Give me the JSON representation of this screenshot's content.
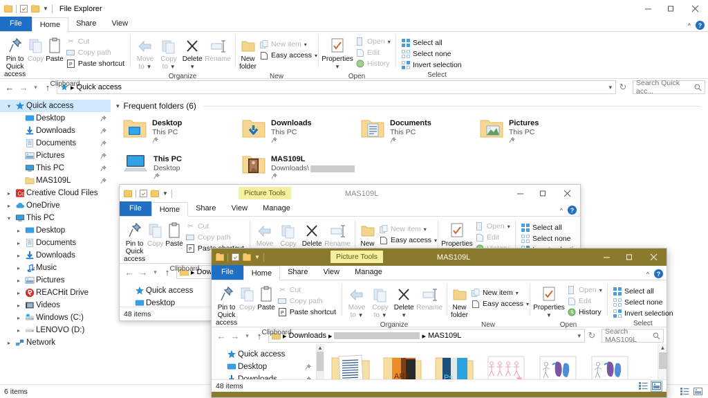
{
  "ribbon": {
    "clipboard": {
      "label": "Clipboard",
      "pin": "Pin to Quick\naccess",
      "pin_line1": "Pin to Quick",
      "pin_line2": "access",
      "copy": "Copy",
      "paste": "Paste",
      "cut": "Cut",
      "copy_path": "Copy path",
      "paste_shortcut": "Paste shortcut"
    },
    "organize": {
      "label": "Organize",
      "move_to_l1": "Move",
      "move_to_l2": "to",
      "copy_to_l1": "Copy",
      "copy_to_l2": "to",
      "delete": "Delete",
      "rename": "Rename"
    },
    "new": {
      "label": "New",
      "new_folder_l1": "New",
      "new_folder_l2": "folder",
      "new_item": "New item",
      "easy_access": "Easy access"
    },
    "open": {
      "label": "Open",
      "properties": "Properties",
      "open": "Open",
      "edit": "Edit",
      "history": "History"
    },
    "select": {
      "label": "Select",
      "select_all": "Select all",
      "select_none": "Select none",
      "invert_selection": "Invert selection"
    },
    "tabs": {
      "file": "File",
      "home": "Home",
      "share": "Share",
      "view": "View",
      "manage": "Manage"
    }
  },
  "window_main": {
    "title": "File Explorer",
    "address": {
      "crumb_root": "Quick access"
    },
    "search_placeholder": "Search Quick acc...",
    "frequent_header": "Frequent folders (6)",
    "status_items": "6 items",
    "minimize": "—",
    "maximize": "❐",
    "close": "✕",
    "tiles": [
      {
        "name": "Desktop",
        "sub": "This PC",
        "icon": "folder-desktop-icon",
        "pinned": true
      },
      {
        "name": "Downloads",
        "sub": "This PC",
        "icon": "folder-downloads-icon",
        "pinned": true
      },
      {
        "name": "Documents",
        "sub": "This PC",
        "icon": "folder-documents-icon",
        "pinned": true
      },
      {
        "name": "Pictures",
        "sub": "This PC",
        "icon": "folder-pictures-icon",
        "pinned": true
      },
      {
        "name": "This PC",
        "sub": "Desktop",
        "icon": "this-pc-icon",
        "pinned": true
      },
      {
        "name": "MAS109L",
        "sub": "Downloads\\",
        "icon": "folder-photo-icon",
        "pinned": true,
        "redacted": true
      }
    ],
    "nav": {
      "quick_access": "Quick access",
      "items": [
        {
          "label": "Quick access",
          "icon": "star-icon",
          "indent": 0,
          "expander": "v",
          "selected": true,
          "pin": false
        },
        {
          "label": "Desktop",
          "icon": "desktop-icon",
          "indent": 1,
          "expander": "",
          "selected": false,
          "pin": true
        },
        {
          "label": "Downloads",
          "icon": "download-icon",
          "indent": 1,
          "expander": "",
          "selected": false,
          "pin": true
        },
        {
          "label": "Documents",
          "icon": "document-icon",
          "indent": 1,
          "expander": "",
          "selected": false,
          "pin": true
        },
        {
          "label": "Pictures",
          "icon": "picture-icon",
          "indent": 1,
          "expander": "",
          "selected": false,
          "pin": true
        },
        {
          "label": "This PC",
          "icon": "monitor-icon",
          "indent": 1,
          "expander": "",
          "selected": false,
          "pin": true
        },
        {
          "label": "MAS109L",
          "icon": "folder-icon",
          "indent": 1,
          "expander": "",
          "selected": false,
          "pin": true
        },
        {
          "label": "Creative Cloud Files",
          "icon": "creative-cloud-icon",
          "indent": 0,
          "expander": ">",
          "selected": false,
          "pin": false
        },
        {
          "label": "OneDrive",
          "icon": "onedrive-icon",
          "indent": 0,
          "expander": ">",
          "selected": false,
          "pin": false
        },
        {
          "label": "This PC",
          "icon": "monitor-icon",
          "indent": 0,
          "expander": "v",
          "selected": false,
          "pin": false
        },
        {
          "label": "Desktop",
          "icon": "desktop-icon",
          "indent": 1,
          "expander": ">",
          "selected": false,
          "pin": false
        },
        {
          "label": "Documents",
          "icon": "document-icon",
          "indent": 1,
          "expander": ">",
          "selected": false,
          "pin": false
        },
        {
          "label": "Downloads",
          "icon": "download-icon",
          "indent": 1,
          "expander": ">",
          "selected": false,
          "pin": false
        },
        {
          "label": "Music",
          "icon": "music-note-icon",
          "indent": 1,
          "expander": ">",
          "selected": false,
          "pin": false
        },
        {
          "label": "Pictures",
          "icon": "picture-icon",
          "indent": 1,
          "expander": ">",
          "selected": false,
          "pin": false
        },
        {
          "label": "REACHit Drive",
          "icon": "reachit-icon",
          "indent": 1,
          "expander": ">",
          "selected": false,
          "pin": false
        },
        {
          "label": "Videos",
          "icon": "video-icon",
          "indent": 1,
          "expander": ">",
          "selected": false,
          "pin": false
        },
        {
          "label": "Windows (C:)",
          "icon": "drive-windows-icon",
          "indent": 1,
          "expander": ">",
          "selected": false,
          "pin": false
        },
        {
          "label": "LENOVO (D:)",
          "icon": "drive-icon",
          "indent": 1,
          "expander": ">",
          "selected": false,
          "pin": false
        },
        {
          "label": "Network",
          "icon": "network-icon",
          "indent": 0,
          "expander": ">",
          "selected": false,
          "pin": false
        }
      ]
    }
  },
  "window_middle": {
    "title": "MAS109L",
    "context_tab": "Picture Tools",
    "status_items": "48 items",
    "address_crumb1": "Dow",
    "nav_items": [
      {
        "label": "Quick access",
        "icon": "star-icon"
      },
      {
        "label": "Desktop",
        "icon": "desktop-icon"
      }
    ],
    "minimize": "—",
    "maximize": "❐",
    "close": "✕"
  },
  "window_front": {
    "title": "MAS109L",
    "context_tab": "Picture Tools",
    "status_items": "48 items",
    "search_placeholder": "Search MAS109L",
    "breadcrumbs": [
      {
        "text": "Downloads",
        "redacted": false
      },
      {
        "text": "",
        "redacted": true
      },
      {
        "text": "MAS109L",
        "redacted": false
      }
    ],
    "nav_items": [
      {
        "label": "Quick access",
        "icon": "star-icon",
        "pin": false
      },
      {
        "label": "Desktop",
        "icon": "desktop-icon",
        "pin": true
      },
      {
        "label": "Downloads",
        "icon": "download-icon",
        "pin": true
      }
    ],
    "thumbnails": [
      {
        "name": "folder-notes-thumb",
        "kind": "folder"
      },
      {
        "name": "folder-art-thumb",
        "kind": "folder"
      },
      {
        "name": "folder-ps-thumb",
        "kind": "folder"
      },
      {
        "name": "image-sketch-thumb",
        "kind": "image"
      },
      {
        "name": "image-figures-1-thumb",
        "kind": "image"
      },
      {
        "name": "image-figures-2-thumb",
        "kind": "image"
      }
    ],
    "minimize": "—",
    "maximize": "❐",
    "close": "✕"
  },
  "colors": {
    "accent_blue": "#1f6fc4",
    "selection_blue": "#cfe8fc",
    "folder_yellow": "#f5c869",
    "active_title_olive": "#8a7a2e",
    "context_tab_yellow": "#f5f0a0",
    "window_white": "#ffffff"
  }
}
